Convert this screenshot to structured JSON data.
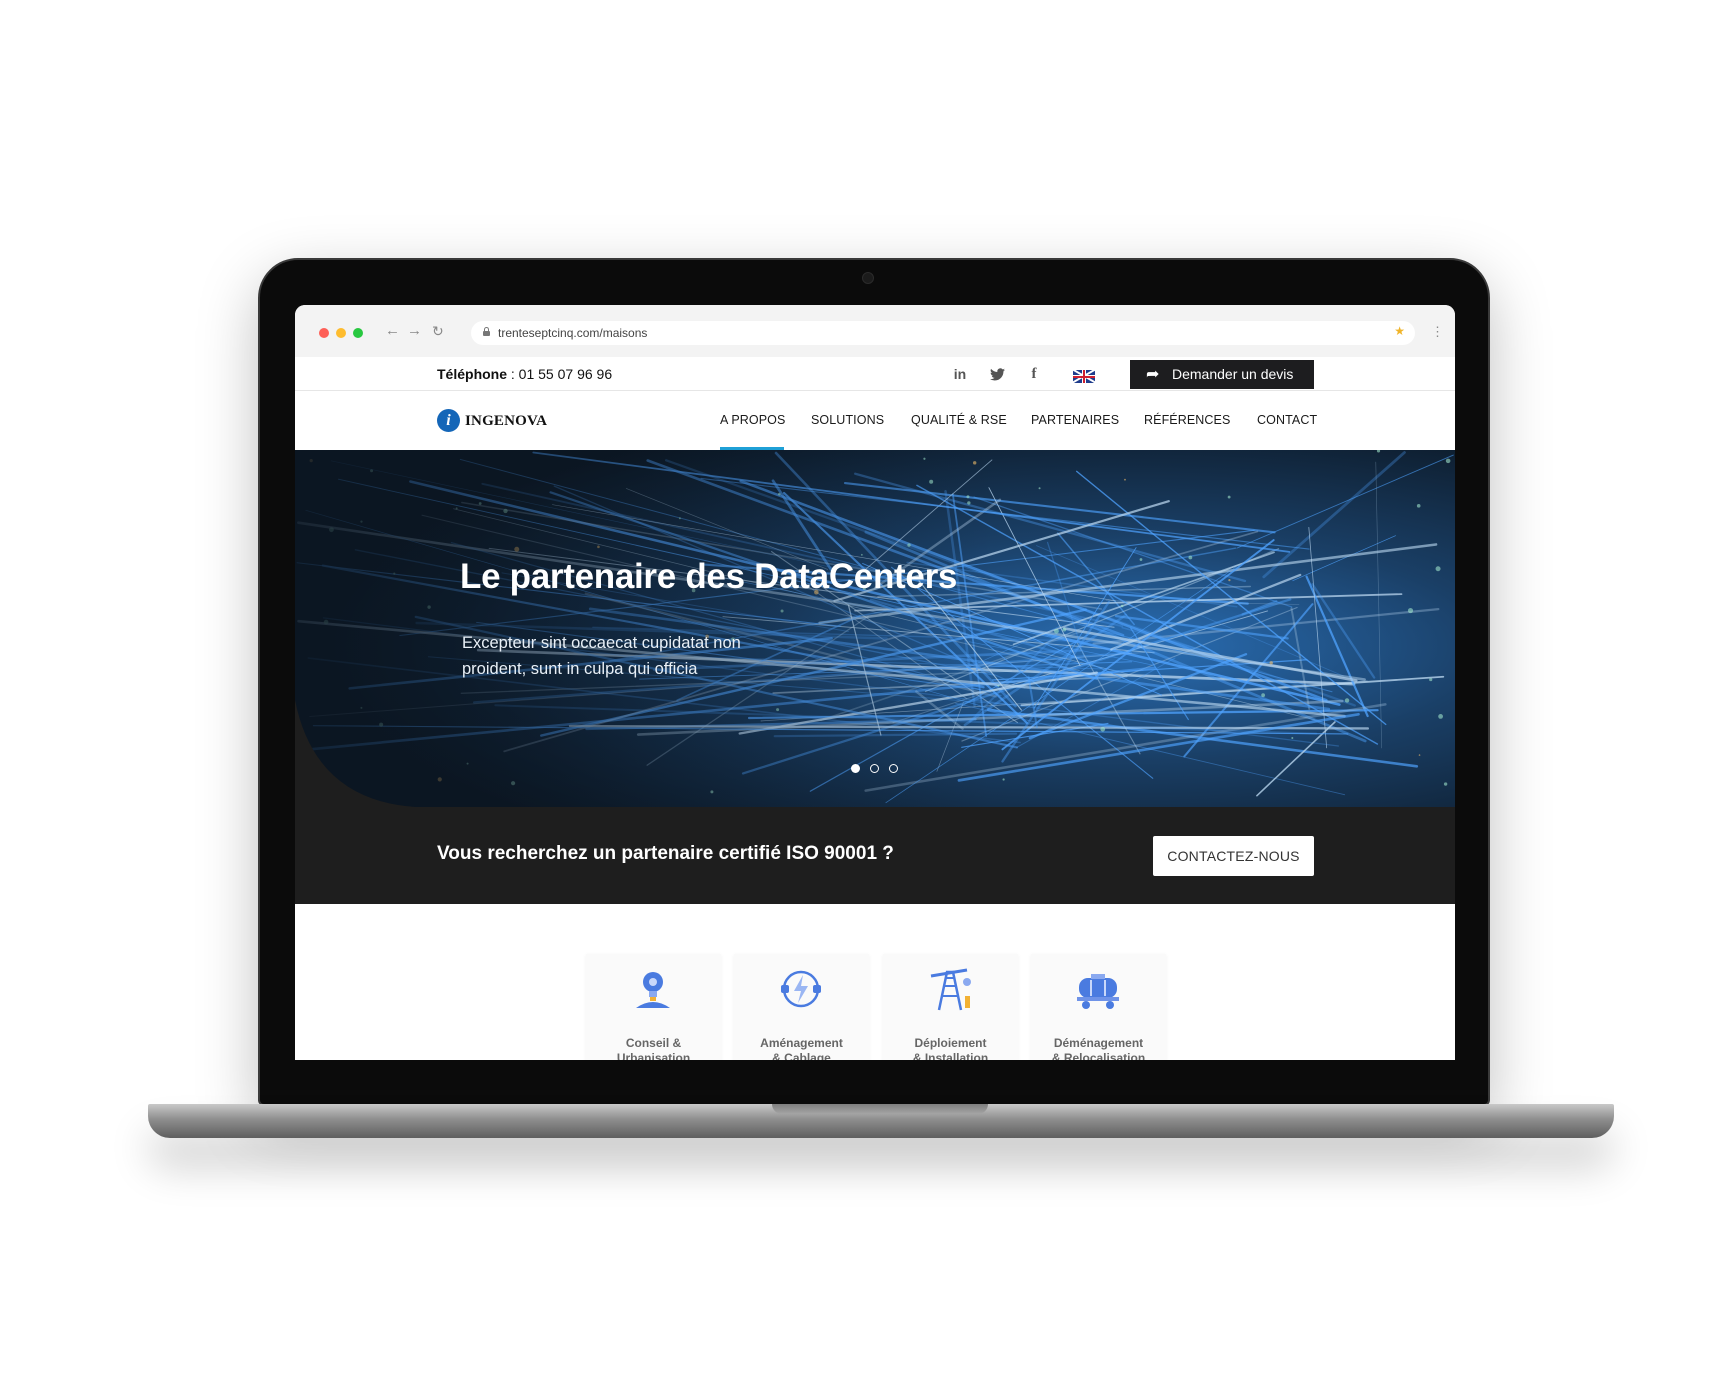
{
  "browser": {
    "url": "trenteseptcinq.com/maisons"
  },
  "topbar": {
    "phone_label": "Téléphone",
    "phone_number": " : 01 55 07 96 96",
    "social": [
      "linkedin-icon",
      "twitter-icon",
      "facebook-icon"
    ],
    "quote_button": "Demander un devis"
  },
  "header": {
    "logo": "INGENOVA",
    "logo_mark": "i",
    "menu": [
      "A PROPOS",
      "SOLUTIONS",
      "QUALITÉ & RSE",
      "PARTENAIRES",
      "RÉFÉRENCES",
      "CONTACT"
    ],
    "active_index": 0
  },
  "hero": {
    "title": "Le partenaire des DataCenters",
    "subtitle": "Excepteur sint occaecat cupidatat non proident, sunt in culpa qui officia",
    "slides": 3,
    "active_slide": 1
  },
  "banner": {
    "text": "Vous recherchez un partenaire certifié ISO 90001 ?",
    "button": "CONTACTEZ-NOUS"
  },
  "services": [
    {
      "line1": "Conseil &",
      "line2": "Urbanisation",
      "icon": "lightbulb-icon"
    },
    {
      "line1": "Aménagement",
      "line2": "& Cablage",
      "icon": "power-plug-icon"
    },
    {
      "line1": "Déploiement",
      "line2": "& Installation",
      "icon": "oil-pump-icon"
    },
    {
      "line1": "Déménagement",
      "line2": "& Relocalisation",
      "icon": "tank-wagon-icon"
    }
  ],
  "colors": {
    "accent": "#1fa0d6",
    "brand": "#1466b8",
    "dark": "#1e1e1e",
    "icon_blue": "#4a7be0"
  }
}
